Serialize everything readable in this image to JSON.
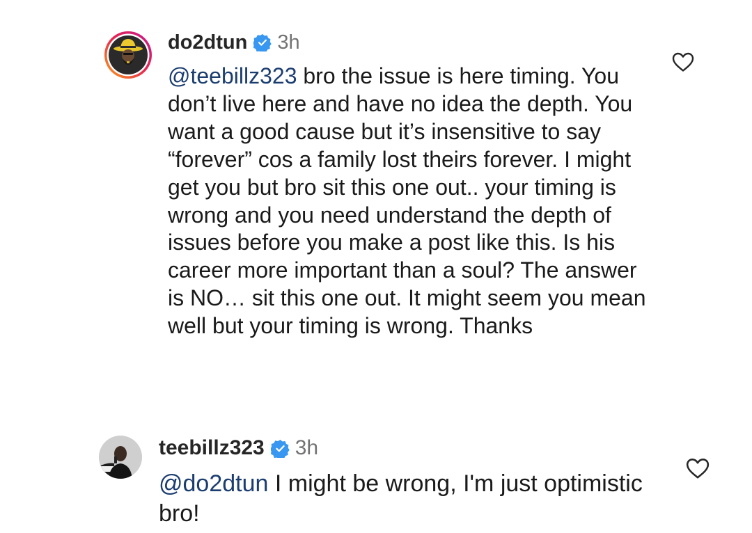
{
  "comments": [
    {
      "username": "do2dtun",
      "verified": true,
      "time": "3h",
      "mention": "@teebillz323",
      "text": " bro the issue is here timing. You don’t live here and have no idea the depth. You want a good cause but it’s insensitive to say “forever” cos a family lost theirs forever. I might get you but bro sit this one out.. your timing is wrong and you need understand the depth of issues before you make a post like this. Is his career more important than a soul? The answer is NO… sit this one out. It might seem you mean well but your timing is wrong. Thanks",
      "like_icon": "heart-outline-icon"
    },
    {
      "username": "teebillz323",
      "verified": true,
      "time": "3h",
      "mention": "@do2dtun",
      "text": " I might be wrong, I'm just optimistic bro!",
      "like_icon": "heart-outline-icon"
    }
  ],
  "colors": {
    "mention": "#1b3d70",
    "verified_badge": "#3897f0",
    "timestamp": "#737373",
    "story_ring_start": "#f9a51a",
    "story_ring_end": "#c2188f"
  }
}
